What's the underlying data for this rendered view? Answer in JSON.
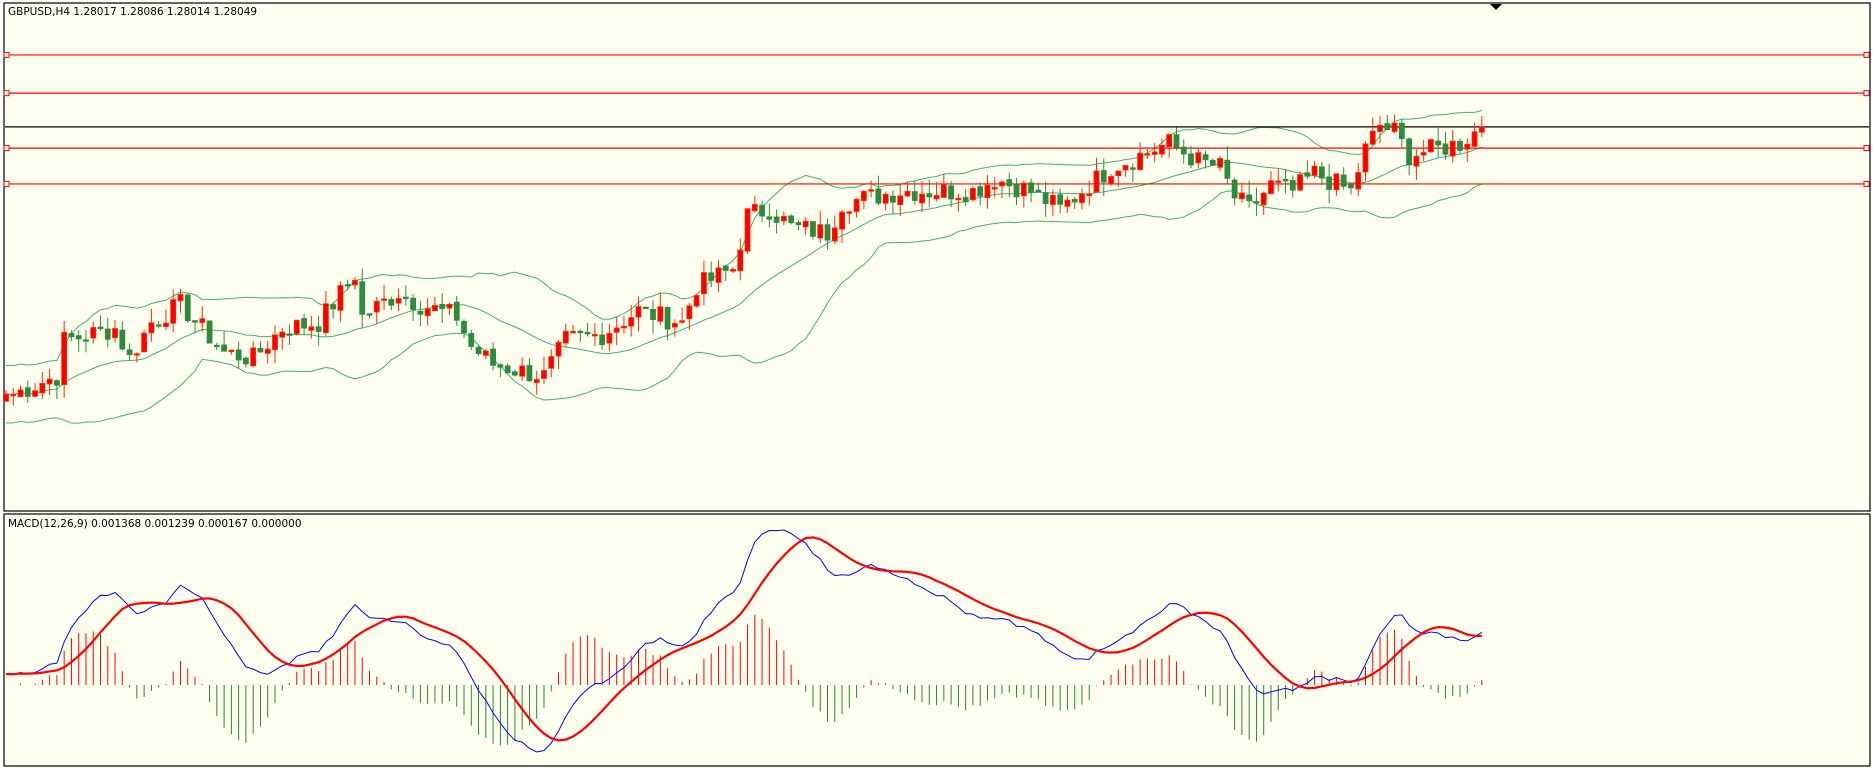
{
  "chart_data": {
    "type": "candlestick",
    "symbol_label": "GBPUSD,H4",
    "ohlc_label": "1.28017 1.28086 1.28014 1.28049",
    "bid": 1.28049,
    "bar_count": 204,
    "close_path": [
      [
        0,
        1.2693
      ],
      [
        1,
        1.2693
      ],
      [
        7,
        1.27005
      ],
      [
        8,
        1.27155
      ],
      [
        15,
        1.27205
      ],
      [
        17,
        1.2708
      ],
      [
        20,
        1.2723
      ],
      [
        24,
        1.27305
      ],
      [
        30,
        1.27105
      ],
      [
        34,
        1.2708
      ],
      [
        38,
        1.27205
      ],
      [
        43,
        1.2723
      ],
      [
        48,
        1.2743
      ],
      [
        49,
        1.27255
      ],
      [
        54,
        1.27355
      ],
      [
        57,
        1.27305
      ],
      [
        62,
        1.27255
      ],
      [
        64,
        1.2713
      ],
      [
        67,
        1.27055
      ],
      [
        74,
        1.27005
      ],
      [
        77,
        1.27155
      ],
      [
        82,
        1.2718
      ],
      [
        87,
        1.2728
      ],
      [
        93,
        1.2723
      ],
      [
        95,
        1.2738
      ],
      [
        100,
        1.27455
      ],
      [
        102,
        1.2768
      ],
      [
        105,
        1.27705
      ],
      [
        108,
        1.2763
      ],
      [
        113,
        1.27605
      ],
      [
        115,
        1.2773
      ],
      [
        123,
        1.2778
      ],
      [
        133,
        1.2778
      ],
      [
        136,
        1.2783
      ],
      [
        141,
        1.2778
      ],
      [
        145,
        1.27705
      ],
      [
        152,
        1.2788
      ],
      [
        156,
        1.2793
      ],
      [
        160,
        1.2798
      ],
      [
        164,
        1.27905
      ],
      [
        167,
        1.2788
      ],
      [
        169,
        1.27755
      ],
      [
        171,
        1.27705
      ],
      [
        174,
        1.27805
      ],
      [
        177,
        1.2778
      ],
      [
        180,
        1.27855
      ],
      [
        185,
        1.2778
      ],
      [
        187,
        1.27955
      ],
      [
        189,
        1.28055
      ],
      [
        191,
        1.2803
      ],
      [
        193,
        1.2793
      ],
      [
        200,
        1.2798
      ],
      [
        203,
        1.28049
      ]
    ],
    "horizontal_levels": [
      1.2835,
      1.2819,
      1.2796,
      1.2781
    ],
    "bollinger": {
      "period": 20,
      "deviation": 2
    },
    "macd": {
      "label": "MACD(12,26,9) 0.001368 0.001239 0.000167 0.000000",
      "fast": 12,
      "slow": 26,
      "signal": 9
    },
    "colors": {
      "background": "#fffff0",
      "bull": "#ff2a00",
      "bear": "#2e8b3e",
      "bands": "#3cb371",
      "levels": "#ff0000",
      "macd_line": "#0000ff",
      "signal_line": "#ff0000",
      "hist_pos": "#ff0000",
      "hist_neg": "#228b22"
    }
  }
}
